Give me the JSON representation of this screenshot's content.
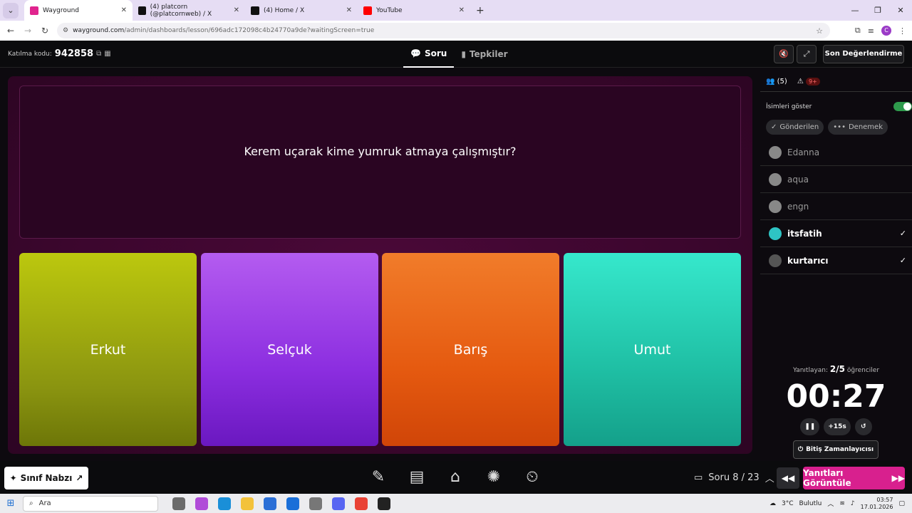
{
  "browser": {
    "tabs": [
      {
        "title": "Wayground",
        "fav_color": "#e0248e",
        "active": true
      },
      {
        "title": "(4) platcorn (@platcornweb) / X",
        "fav_color": "#111111",
        "active": false
      },
      {
        "title": "(4) Home / X",
        "fav_color": "#111111",
        "active": false
      },
      {
        "title": "YouTube",
        "fav_color": "#ff0000",
        "active": false
      }
    ],
    "url_host": "wayground.com",
    "url_path": "/admin/dashboards/lesson/696adc172098c4b24770a9de?waitingScreen=true",
    "profile_initial": "C"
  },
  "header": {
    "join_label": "Katılma kodu:",
    "join_code": "942858",
    "tab_question": "Soru",
    "tab_reactions": "Tepkiler",
    "final_button": "Son Değerlendirme"
  },
  "question": {
    "text": "Kerem uçarak kime yumruk atmaya çalışmıştır?",
    "options": [
      "Erkut",
      "Selçuk",
      "Barış",
      "Umut"
    ]
  },
  "sidebar": {
    "participants_count": "(5)",
    "alert_badge": "9+",
    "show_names_label": "İsimleri göster",
    "filter_submitted": "Gönderilen",
    "filter_trying": "Denemek",
    "players": [
      {
        "name": "Edanna",
        "answered": false
      },
      {
        "name": "aqua",
        "answered": false
      },
      {
        "name": "engn",
        "answered": false
      },
      {
        "name": "itsfatih",
        "answered": true
      },
      {
        "name": "kurtarıcı",
        "answered": true
      }
    ],
    "answered_label": "Yanıtlayan:",
    "answered_value": "2/5",
    "answered_suffix": "öğrenciler",
    "timer": "00:27",
    "add_time": "+15s",
    "end_timer": "Bitiş Zamanlayıcısı"
  },
  "footer": {
    "pulse_label": "Sınıf Nabzı",
    "question_nav": "Soru 8 / 23",
    "show_answers": "Yanıtları Görüntüle"
  },
  "taskbar": {
    "search_placeholder": "Ara",
    "weather": "3°C",
    "weather_desc": "Bulutlu",
    "time": "03:57",
    "date": "17.01.2026"
  }
}
